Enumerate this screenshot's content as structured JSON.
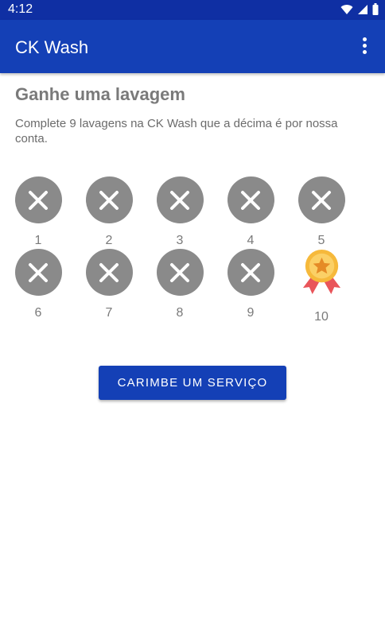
{
  "status_bar": {
    "time": "4:12"
  },
  "app_bar": {
    "title": "CK Wash",
    "menu_icon": "more-vert-icon"
  },
  "loyalty": {
    "heading": "Ganhe uma lavagem",
    "description": "Complete 9 lavagens na CK Wash que a décima é por nossa conta.",
    "stamps": [
      {
        "number": "1",
        "icon": "close-icon"
      },
      {
        "number": "2",
        "icon": "close-icon"
      },
      {
        "number": "3",
        "icon": "close-icon"
      },
      {
        "number": "4",
        "icon": "close-icon"
      },
      {
        "number": "5",
        "icon": "close-icon"
      },
      {
        "number": "6",
        "icon": "close-icon"
      },
      {
        "number": "7",
        "icon": "close-icon"
      },
      {
        "number": "8",
        "icon": "close-icon"
      },
      {
        "number": "9",
        "icon": "close-icon"
      },
      {
        "number": "10",
        "icon": "medal-icon"
      }
    ]
  },
  "action": {
    "label": "CARIMBE UM SERVIÇO"
  },
  "colors": {
    "primary": "#1440b6",
    "status_bar": "#0f2fa3",
    "stamp_gray": "#8a8a8a",
    "medal_gold": "#f6b93b",
    "ribbon_red": "#e9555a"
  }
}
